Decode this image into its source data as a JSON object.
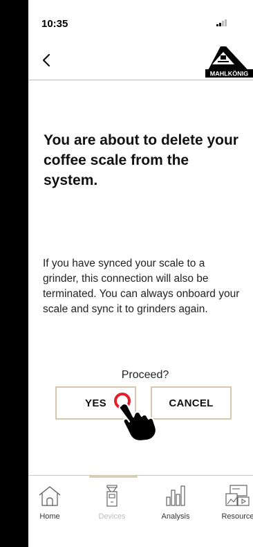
{
  "status_bar": {
    "time": "10:35"
  },
  "header": {
    "back_icon": "chevron-left-icon",
    "logo_text": "MAHLKÖNIG"
  },
  "dialog": {
    "title": "You are about to delete your coffee scale from the system.",
    "message": "If you have synced your scale to a grinder, this connection will also be terminated. You can always onboard your scale and sync it to grinders again.",
    "prompt": "Proceed?",
    "yes_label": "YES",
    "cancel_label": "CANCEL"
  },
  "nav": {
    "items": [
      {
        "label": "Home",
        "icon": "home-icon"
      },
      {
        "label": "Devices",
        "icon": "grinder-icon"
      },
      {
        "label": "Analysis",
        "icon": "bar-chart-icon"
      },
      {
        "label": "Resource",
        "icon": "resources-icon"
      }
    ],
    "active": "Devices"
  },
  "colors": {
    "accent_border": "#d6c8ae",
    "touch_ring": "#e0212a",
    "inactive_label": "#bdbdbd"
  }
}
